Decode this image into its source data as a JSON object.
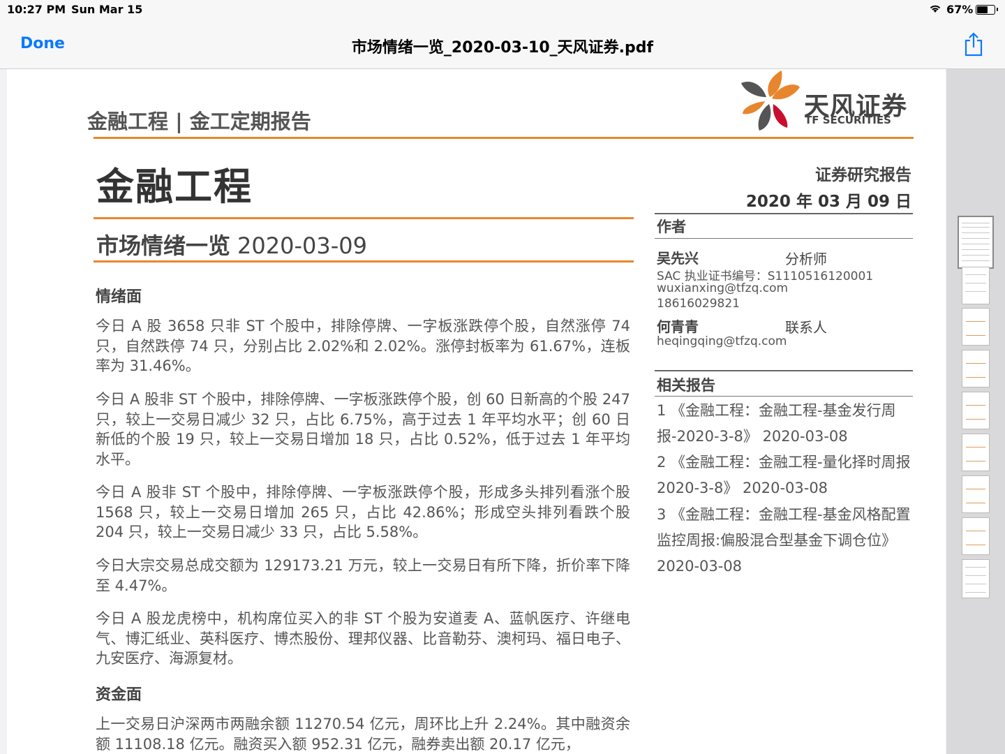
{
  "status_bar": {
    "time": "10:27 PM",
    "date": "Sun Mar 15",
    "battery": "67%",
    "battery_level": 0.67
  },
  "nav": {
    "done_label": "Done",
    "title": "市场情绪一览_2020-03-10_天风证券.pdf",
    "share_icon": "share-icon"
  },
  "colors": {
    "accent": "#0a7aff",
    "rule": "#e8862e",
    "logo_orange": "#e8862e",
    "logo_red": "#c8102e",
    "logo_gray": "#555555"
  },
  "document": {
    "header_section": "金融工程 | 金工定期报告",
    "logo": {
      "cn": "天风证券",
      "en": "TF SECURITIES"
    },
    "main_title": "金融工程",
    "report_type": "证券研究报告",
    "report_date": "2020 年 03 月 09 日",
    "subtitle": "市场情绪一览",
    "subtitle_date": "2020-03-09",
    "sections": [
      {
        "heading": "情绪面"
      },
      {
        "heading": "资金面"
      }
    ],
    "paragraphs": [
      "今日 A 股 3658 只非 ST 个股中，排除停牌、一字板涨跌停个股，自然涨停 74 只，自然跌停 74 只，分别占比 2.02%和 2.02%。涨停封板率为 61.67%，连板率为 31.46%。",
      "今日 A 股非 ST 个股中，排除停牌、一字板涨跌停个股，创 60 日新高的个股 247 只，较上一交易日减少 32 只，占比 6.75%，高于过去 1 年平均水平；创 60 日新低的个股 19 只，较上一交易日增加 18 只，占比 0.52%，低于过去 1 年平均水平。",
      "今日 A 股非 ST 个股中，排除停牌、一字板涨跌停个股，形成多头排列看涨个股 1568 只，较上一交易日增加 265 只，占比 42.86%；形成空头排列看跌个股 204 只，较上一交易日减少 33 只，占比 5.58%。",
      "今日大宗交易总成交额为 129173.21 万元，较上一交易日有所下降，折价率下降至 4.47%。",
      "今日 A 股龙虎榜中，机构席位买入的非 ST 个股为安道麦 A、蓝帆医疗、许继电气、博汇纸业、英科医疗、博杰股份、理邦仪器、比音勒芬、澳柯玛、福日电子、九安医疗、海源复材。",
      "上一交易日沪深两市两融余额 11270.54 亿元，周环比上升 2.24%。其中融资余额 11108.18 亿元。融资买入额 952.31 亿元，融券卖出额 20.17 亿元，"
    ],
    "authors_label": "作者",
    "authors": [
      {
        "name": "吴先兴",
        "role": "分析师",
        "sac": "SAC 执业证书编号：S1110516120001",
        "email": "wuxianxing@tfzq.com",
        "phone": "18616029821"
      },
      {
        "name": "何青青",
        "role": "联系人",
        "email": "heqingqing@tfzq.com"
      }
    ],
    "related_label": "相关报告",
    "related": [
      "1 《金融工程：金融工程-基金发行周报-2020-3-8》 2020-03-08",
      "2 《金融工程：金融工程-量化择时周报 2020-3-8》 2020-03-08",
      "3 《金融工程：金融工程-基金风格配置监控周报:偏股混合型基金下调仓位》 2020-03-08"
    ]
  },
  "thumbnails": [
    {
      "page": 1,
      "active": true
    },
    {
      "page": 2
    },
    {
      "page": 3
    },
    {
      "page": 4
    },
    {
      "page": 5
    },
    {
      "page": 6
    },
    {
      "page": 7
    },
    {
      "page": 8
    },
    {
      "page": 9
    }
  ]
}
